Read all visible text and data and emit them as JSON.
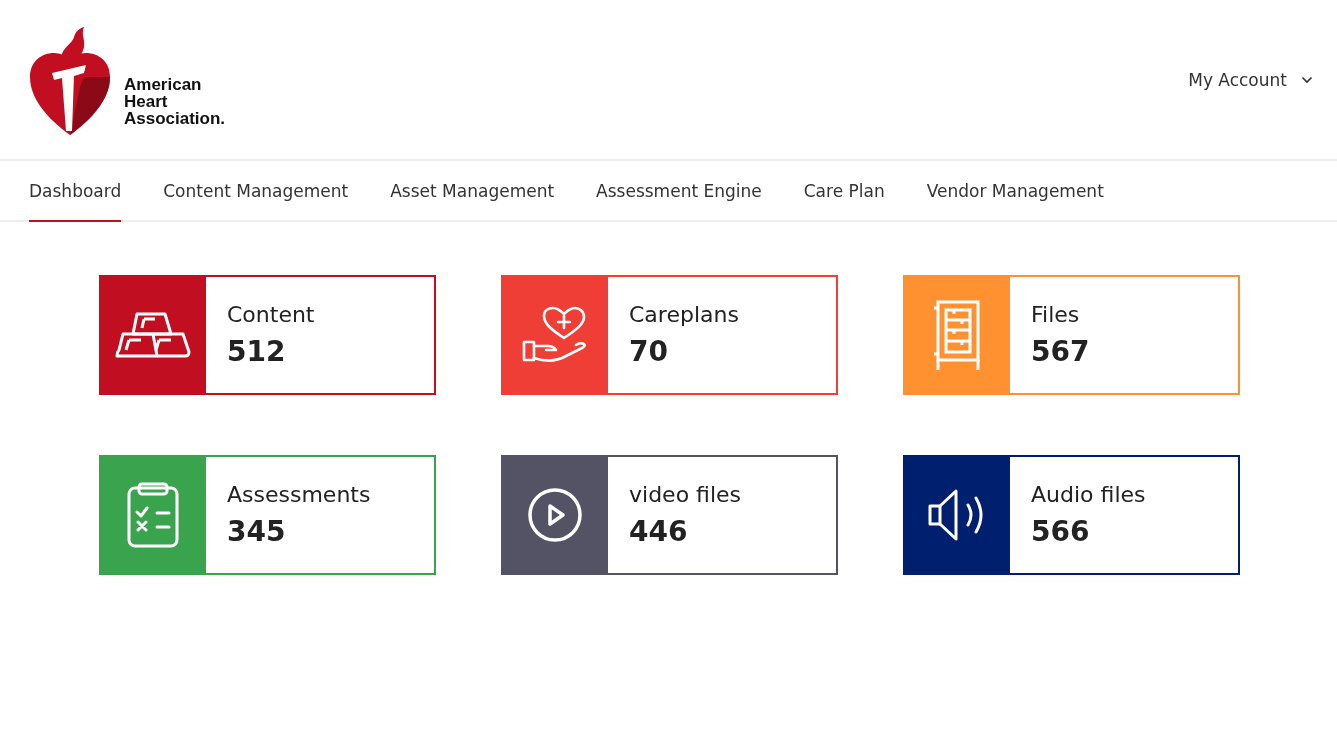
{
  "header": {
    "logo_lines": [
      "American",
      "Heart",
      "Association."
    ],
    "account": "My Account"
  },
  "nav": [
    {
      "label": "Dashboard",
      "selected": true
    },
    {
      "label": "Content Management",
      "selected": false
    },
    {
      "label": "Asset Management",
      "selected": false
    },
    {
      "label": "Assessment Engine",
      "selected": false
    },
    {
      "label": "Care Plan",
      "selected": false
    },
    {
      "label": "Vendor Management",
      "selected": false
    }
  ],
  "cards": [
    {
      "kind": "gold",
      "title": "Content",
      "count": "512",
      "color": "#c10e21"
    },
    {
      "kind": "care",
      "title": "Careplans",
      "count": "70",
      "color": "#ef3e36"
    },
    {
      "kind": "files",
      "title": "Files",
      "count": "567",
      "color": "#ff9130"
    },
    {
      "kind": "checklist",
      "title": "Assessments",
      "count": "345",
      "color": "#3aa34d"
    },
    {
      "kind": "video",
      "title": "video files",
      "count": "446",
      "color": "#545265"
    },
    {
      "kind": "audio",
      "title": "Audio files",
      "count": "566",
      "color": "#001f6e"
    }
  ]
}
